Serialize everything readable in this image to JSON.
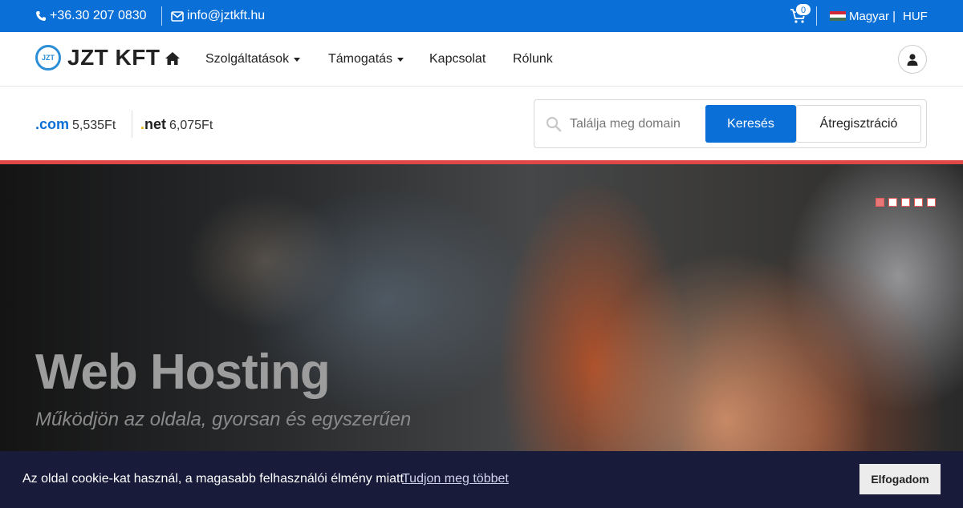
{
  "topbar": {
    "phone": "+36.30 207 0830",
    "email": "info@jztkft.hu",
    "cart_count": "0",
    "language": "Magyar |",
    "currency": "HUF"
  },
  "navbar": {
    "logo_badge": "JZT",
    "logo_text": "JZT KFT",
    "items": [
      {
        "label": "Szolgáltatások"
      },
      {
        "label": "Támogatás"
      },
      {
        "label": "Kapcsolat"
      },
      {
        "label": "Rólunk"
      }
    ]
  },
  "domain": {
    "tlds": [
      {
        "name": ".com",
        "price": "5,535Ft",
        "color": "#0a6fd6"
      },
      {
        "name": ".net",
        "price": "6,075Ft",
        "color": "#e8b90a"
      }
    ],
    "search_placeholder": "Találja meg domain",
    "search_button": "Keresés",
    "transfer_button": "Átregisztráció"
  },
  "hero": {
    "title": "Web Hosting",
    "subtitle": "Működjön az oldala, gyorsan és egyszerűen",
    "slide_count": 5,
    "active_slide": 1
  },
  "cookie": {
    "message": "Az oldal cookie-kat használ, a magasabb felhasználói élmény miatt",
    "learn_more": "Tudjon meg többet",
    "accept": "Elfogadom"
  }
}
